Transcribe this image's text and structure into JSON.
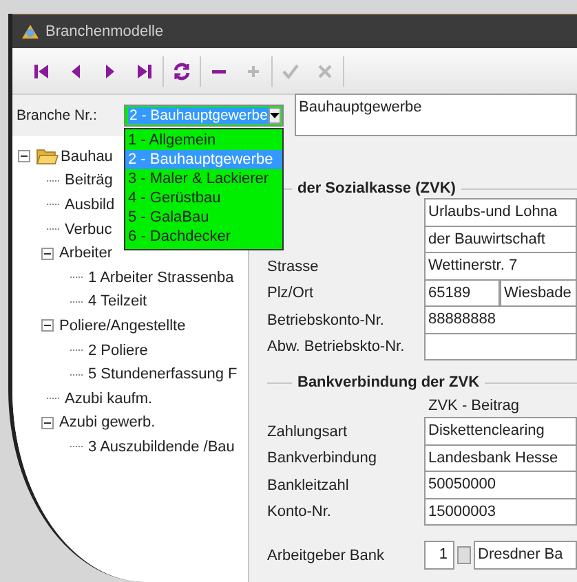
{
  "window": {
    "title": "Branchenmodelle"
  },
  "toolbar": [
    [
      {
        "kind": "first",
        "disabled": false
      },
      {
        "kind": "prev",
        "disabled": false
      },
      {
        "kind": "next",
        "disabled": false
      },
      {
        "kind": "last",
        "disabled": false
      }
    ],
    [
      {
        "kind": "refresh",
        "disabled": false
      }
    ],
    [
      {
        "kind": "remove",
        "disabled": false
      },
      {
        "kind": "add",
        "disabled": true
      }
    ],
    [
      {
        "kind": "confirm",
        "disabled": true
      },
      {
        "kind": "cancel",
        "disabled": true
      }
    ]
  ],
  "branche": {
    "label": "Branche Nr.:",
    "value": "2 - Bauhauptgewerbe",
    "name": "Bauhauptgewerbe",
    "options": [
      {
        "label": "1 - Allgemein",
        "selected": false
      },
      {
        "label": "2 - Bauhauptgewerbe",
        "selected": true
      },
      {
        "label": "3 - Maler & Lackierer",
        "selected": false
      },
      {
        "label": "4 - Gerüstbau",
        "selected": false
      },
      {
        "label": "5 - GalaBau",
        "selected": false
      },
      {
        "label": "6 - Dachdecker",
        "selected": false
      }
    ]
  },
  "tree": [
    {
      "label": "Bauhau",
      "expanded": true,
      "children": [
        {
          "label": "Beiträg"
        },
        {
          "label": "Ausbild"
        },
        {
          "label": "Verbuc"
        },
        {
          "label": "Arbeiter",
          "expanded": true,
          "children": [
            {
              "label": "1 Arbeiter Strassenba"
            },
            {
              "label": "4 Teilzeit"
            }
          ]
        },
        {
          "label": "Poliere/Angestellte",
          "expanded": true,
          "children": [
            {
              "label": "2 Poliere"
            },
            {
              "label": "5 Stundenerfassung F"
            }
          ]
        },
        {
          "label": "Azubi kaufm."
        },
        {
          "label": "Azubi gewerb.",
          "expanded": true,
          "children": [
            {
              "label": "3 Auszubildende /Bau"
            }
          ]
        }
      ]
    }
  ],
  "sozialkasse": {
    "title": "der Sozialkasse (ZVK)",
    "rows": [
      {
        "values": [
          "Urlaubs-und Lohna"
        ]
      },
      {
        "values": [
          "der Bauwirtschaft"
        ]
      },
      {
        "label": "Strasse",
        "values": [
          "Wettinerstr. 7"
        ]
      },
      {
        "label": "Plz/Ort",
        "values": [
          "65189",
          "Wiesbade"
        ]
      },
      {
        "label": "Betriebskonto-Nr.",
        "values": [
          "88888888"
        ]
      },
      {
        "label": "Abw. Betriebskto-Nr."
      }
    ]
  },
  "bank": {
    "title": "Bankverbindung der ZVK",
    "column": "ZVK - Beitrag",
    "rows": [
      {
        "label": "Zahlungsart",
        "value": "Diskettenclearing"
      },
      {
        "label": "Bankverbindung",
        "value": "Landesbank Hesse"
      },
      {
        "label": "Bankleitzahl",
        "value": "50050000"
      },
      {
        "label": "Konto-Nr.",
        "value": "15000003"
      }
    ]
  },
  "employer_bank": {
    "label": "Arbeitgeber Bank",
    "number": "1",
    "name": "Dresdner Ba"
  }
}
